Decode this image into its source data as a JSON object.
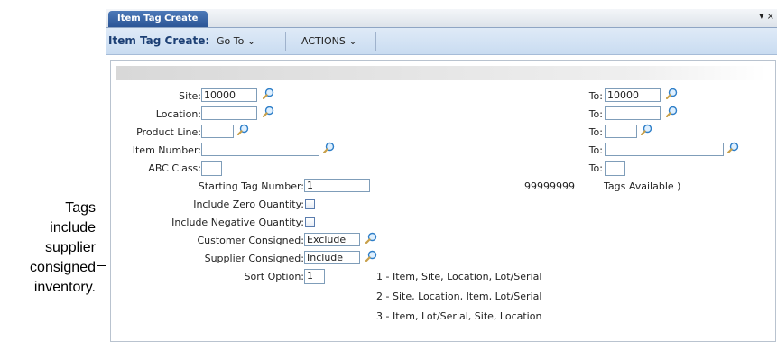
{
  "tab": {
    "title": "Item Tag Create",
    "controls": "▾ ×"
  },
  "menu": {
    "title": "Item Tag Create:",
    "goto": "Go To ⌄",
    "actions": "ACTIONS ⌄"
  },
  "form": {
    "site": {
      "label": "Site:",
      "from": "10000",
      "to_label": "To:",
      "to": "10000"
    },
    "location": {
      "label": "Location:",
      "from": "",
      "to_label": "To:",
      "to": ""
    },
    "product_line": {
      "label": "Product Line:",
      "from": "",
      "to_label": "To:",
      "to": ""
    },
    "item_number": {
      "label": "Item Number:",
      "from": "",
      "to_label": "To:",
      "to": ""
    },
    "abc_class": {
      "label": "ABC Class:",
      "from": "",
      "to_label": "To:",
      "to": ""
    },
    "starting_tag": {
      "label": "Starting Tag Number:",
      "value": "1"
    },
    "tags_available": {
      "count": "99999999",
      "text": "Tags Available )"
    },
    "include_zero": {
      "label": "Include Zero Quantity:",
      "checked": false
    },
    "include_negative": {
      "label": "Include Negative Quantity:",
      "checked": false
    },
    "customer_consigned": {
      "label": "Customer Consigned:",
      "value": "Exclude"
    },
    "supplier_consigned": {
      "label": "Supplier Consigned:",
      "value": "Include"
    },
    "sort_option": {
      "label": "Sort Option:",
      "value": "1"
    },
    "sort_options": [
      "1 - Item, Site, Location, Lot/Serial",
      "2 - Site, Location, Item, Lot/Serial",
      "3 - Item, Lot/Serial, Site, Location"
    ]
  },
  "annotation": {
    "lines": [
      "Tags",
      "include",
      "supplier",
      "consigned",
      "inventory."
    ]
  },
  "icons": {
    "lookup": "magnifier-icon",
    "dropdown": "chevron-down-icon"
  },
  "colors": {
    "tab": "#2b5596",
    "menubar": "#d5e4f5",
    "title": "#1c3f74"
  }
}
